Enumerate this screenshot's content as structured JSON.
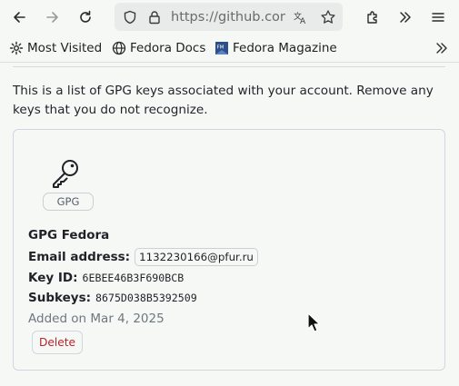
{
  "browser": {
    "url": "https://github.com/settings/keys",
    "back_label": "Back",
    "forward_label": "Forward",
    "reload_label": "Reload"
  },
  "bookmarks": {
    "items": [
      {
        "label": "Most Visited",
        "icon": "gear-icon"
      },
      {
        "label": "Fedora Docs",
        "icon": "globe-icon"
      },
      {
        "label": "Fedora Magazine",
        "icon": "fm-icon"
      }
    ]
  },
  "main": {
    "intro": "This is a list of GPG keys associated with your account. Remove any keys that you do not recognize.",
    "key": {
      "badge": "GPG",
      "name": "GPG Fedora",
      "email_label": "Email address:",
      "email": "1132230166@pfur.ru",
      "keyid_label": "Key ID:",
      "keyid": "6EBEE46B3F690BCB",
      "subkeys_label": "Subkeys:",
      "subkeys": "8675D038B5392509",
      "added": "Added on Mar 4, 2025",
      "delete_label": "Delete"
    }
  },
  "colors": {
    "accent_danger": "#b3262d",
    "border": "#d0d7de",
    "muted": "#6e7781"
  }
}
